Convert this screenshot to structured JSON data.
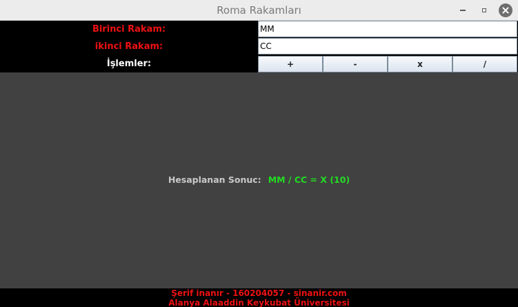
{
  "window": {
    "title": "Roma Rakamları",
    "controls": [
      "minimize-icon",
      "maximize-icon",
      "close-icon"
    ]
  },
  "form": {
    "first_label": "Birinci Rakam:",
    "first_value": "MM",
    "second_label": "ikinci Rakam:",
    "second_value": "CC",
    "ops_label": "İşlemler:",
    "ops": [
      "+",
      "-",
      "x",
      "/"
    ]
  },
  "result": {
    "label": "Hesaplanan Sonuc:",
    "value": "MM / CC = X (10)"
  },
  "footer": {
    "line1": "Şerif inanır - 160204057 - sinanir.com",
    "line2": "Alanya Alaaddin Keykubat Üniversitesi"
  },
  "colors": {
    "label_red": "#ee1111",
    "result_green": "#22dd22",
    "panel_dark": "#414141",
    "form_bg": "#000000"
  }
}
